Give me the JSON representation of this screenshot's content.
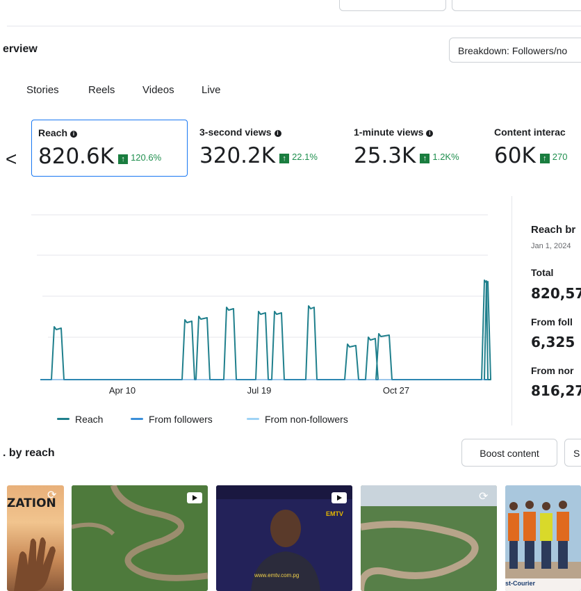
{
  "header": {
    "section_title": "erview",
    "breakdown_button": "Breakdown: Followers/no"
  },
  "tabs": [
    "Stories",
    "Reels",
    "Videos",
    "Live"
  ],
  "metrics": {
    "prev_arrow": "<",
    "items": [
      {
        "label": "Reach",
        "value": "820.6K",
        "delta": "120.6%"
      },
      {
        "label": "3-second views",
        "value": "320.2K",
        "delta": "22.1%"
      },
      {
        "label": "1-minute views",
        "value": "25.3K",
        "delta": "1.2K%"
      },
      {
        "label": "Content interac",
        "value": "60K",
        "delta": "270"
      }
    ],
    "info_glyph": "i",
    "up_glyph": "↑"
  },
  "chart_data": {
    "type": "line",
    "x_tick_labels": [
      "Apr 10",
      "Jul 19",
      "Oct 27"
    ],
    "series": [
      {
        "name": "Reach",
        "color": "#1f7f8c"
      },
      {
        "name": "From followers",
        "color": "#3b8fd9"
      },
      {
        "name": "From non-followers",
        "color": "#9fd3f5"
      }
    ],
    "grid": true
  },
  "breakdown": {
    "title": "Reach br",
    "date": "Jan 1, 2024",
    "total_label": "Total",
    "total_value": "820,57",
    "followers_label": "From foll",
    "followers_value": "6,325",
    "nonfollowers_label": "From nor",
    "nonfollowers_value": "816,27"
  },
  "content": {
    "title": ". by reach",
    "boost_button": "Boost content",
    "second_button": "S",
    "thumbnails": [
      {
        "kind": "image",
        "caption": "ZATION"
      },
      {
        "kind": "video"
      },
      {
        "kind": "video",
        "watermark": "EMTV",
        "url_text": "www.emtv.com.pg"
      },
      {
        "kind": "link"
      },
      {
        "kind": "image",
        "caption": "st-Courier"
      }
    ]
  }
}
